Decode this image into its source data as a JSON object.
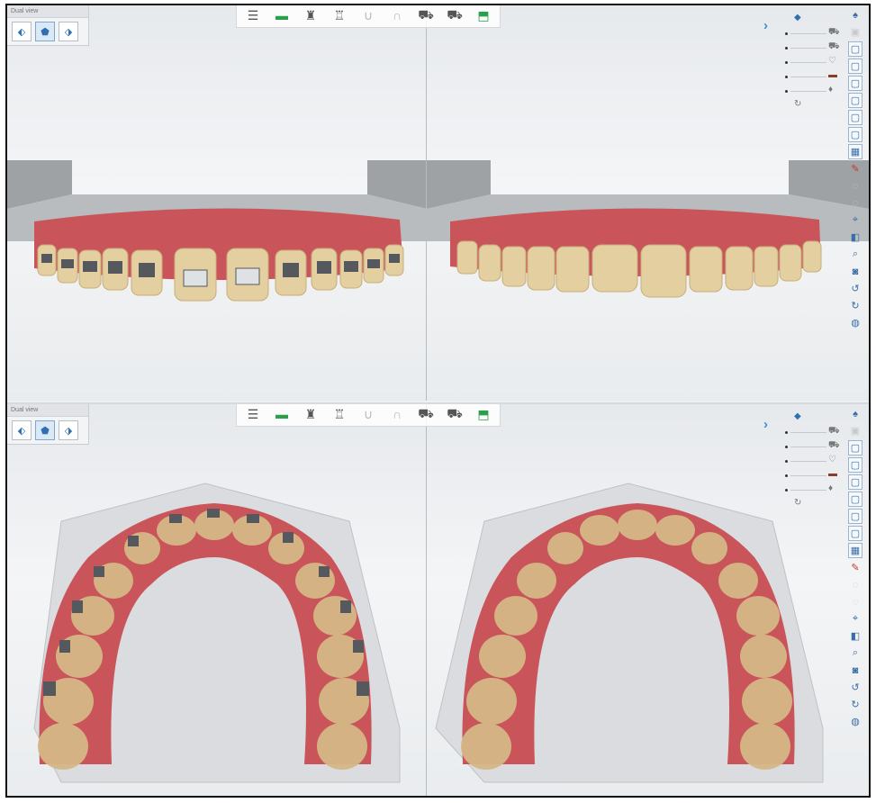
{
  "window": {
    "dual_view_label": "Dual view",
    "panels": [
      {
        "id": "top",
        "dual_view_title": "Dual view",
        "toolbar": [
          {
            "icon": "jaw-stack-icon",
            "glyph": "☰"
          },
          {
            "icon": "model-green-icon",
            "glyph": "▬"
          },
          {
            "icon": "tooth-upper-icon",
            "glyph": "♜"
          },
          {
            "icon": "tooth-lower-icon",
            "glyph": "♖"
          },
          {
            "icon": "arch-lower-icon",
            "glyph": "∪"
          },
          {
            "icon": "arch-upper-icon",
            "glyph": "∩"
          },
          {
            "icon": "bracket-left-icon",
            "glyph": "⛟"
          },
          {
            "icon": "bracket-right-icon",
            "glyph": "⛟"
          },
          {
            "icon": "export-icon",
            "glyph": "⬒"
          }
        ]
      },
      {
        "id": "bottom",
        "dual_view_title": "Dual view",
        "toolbar": [
          {
            "icon": "jaw-stack-icon",
            "glyph": "☰"
          },
          {
            "icon": "model-green-icon",
            "glyph": "▬"
          },
          {
            "icon": "tooth-upper-icon",
            "glyph": "♜"
          },
          {
            "icon": "tooth-lower-icon",
            "glyph": "♖"
          },
          {
            "icon": "arch-lower-icon",
            "glyph": "∪"
          },
          {
            "icon": "arch-upper-icon",
            "glyph": "∩"
          },
          {
            "icon": "bracket-left-icon",
            "glyph": "⛟"
          },
          {
            "icon": "bracket-right-icon",
            "glyph": "⛟"
          },
          {
            "icon": "export-icon",
            "glyph": "⬒"
          }
        ]
      }
    ],
    "colors": {
      "gum": "#c9555a",
      "tooth": "#e4cfa0",
      "bracket": "#55585c",
      "accent_blue": "#3b8fd9",
      "base_plate": "#a9acaf"
    }
  }
}
